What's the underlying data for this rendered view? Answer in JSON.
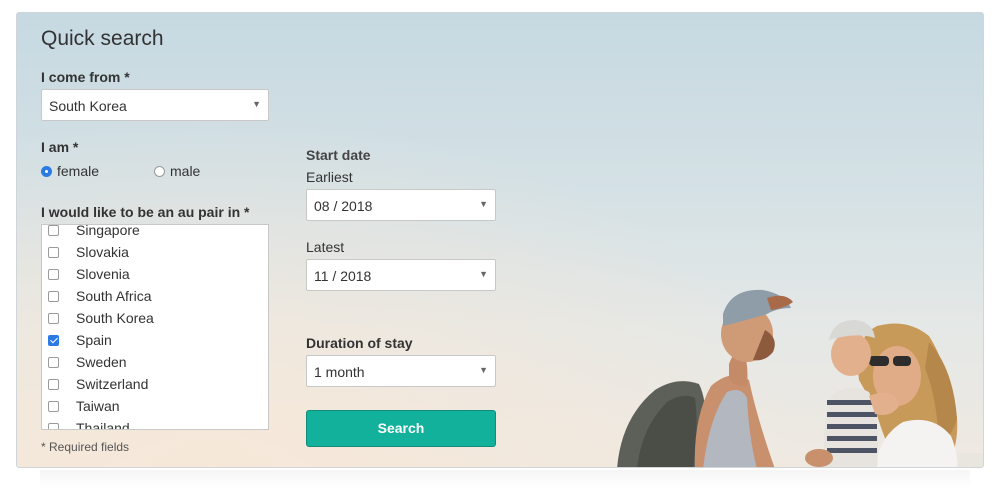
{
  "form": {
    "title": "Quick search",
    "come_from": {
      "label": "I come from *",
      "value": "South Korea"
    },
    "gender": {
      "label": "I am *",
      "options": [
        {
          "label": "female",
          "selected": true
        },
        {
          "label": "male",
          "selected": false
        }
      ]
    },
    "countries": {
      "label": "I would like to be an au pair in *",
      "items": [
        {
          "label": "Singapore",
          "checked": false
        },
        {
          "label": "Slovakia",
          "checked": false
        },
        {
          "label": "Slovenia",
          "checked": false
        },
        {
          "label": "South Africa",
          "checked": false
        },
        {
          "label": "South Korea",
          "checked": false
        },
        {
          "label": "Spain",
          "checked": true
        },
        {
          "label": "Sweden",
          "checked": false
        },
        {
          "label": "Switzerland",
          "checked": false
        },
        {
          "label": "Taiwan",
          "checked": false
        },
        {
          "label": "Thailand",
          "checked": false
        }
      ]
    },
    "required_note": "* Required fields",
    "start_date": {
      "label": "Start date",
      "earliest": {
        "label": "Earliest",
        "value": "08 / 2018"
      },
      "latest": {
        "label": "Latest",
        "value": "11 / 2018"
      }
    },
    "duration": {
      "label": "Duration of stay",
      "value": "1 month"
    },
    "search_label": "Search"
  },
  "icons": {
    "dropdown": "caret-down-icon",
    "photo": "family-photo"
  },
  "colors": {
    "accent": "#12b19b",
    "checked": "#2c7be5",
    "text": "#333333",
    "sky_top": "#c6d9e1",
    "sky_bottom": "#efe9e1"
  }
}
